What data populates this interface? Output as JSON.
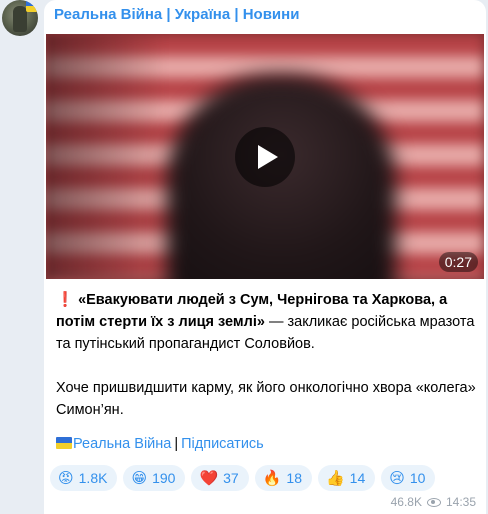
{
  "channel": {
    "title": "Реальна Війна | Україна | Новини",
    "avatar_icon": "channel-avatar"
  },
  "video": {
    "duration": "0:27",
    "play_icon": "play-icon"
  },
  "post": {
    "exclamation": "❗",
    "quote_bold": "«Евакуювати людей з Сум, Чернігова та Харкова, а потім стерти їх з лиця землі»",
    "quote_rest": " — закликає російська мразота та путінський пропагандист Соловйов.",
    "paragraph2": "Хоче пришвидшити карму, як його онкологічно хвора «колега» Симон’ян."
  },
  "links": {
    "channel_link": "Реальна Війна",
    "separator": "|",
    "subscribe_link": "Підписатись"
  },
  "reactions": [
    {
      "emoji": "😡",
      "count": "1.8K"
    },
    {
      "emoji": "😁",
      "count": "190"
    },
    {
      "emoji": "❤️",
      "count": "37"
    },
    {
      "emoji": "🔥",
      "count": "18"
    },
    {
      "emoji": "👍",
      "count": "14"
    },
    {
      "emoji": "😢",
      "count": "10"
    }
  ],
  "meta": {
    "views": "46.8K",
    "time": "14:35"
  },
  "colors": {
    "accent": "#3390ec",
    "background": "#e8edf3",
    "reaction_bg": "#eaf3fb"
  }
}
